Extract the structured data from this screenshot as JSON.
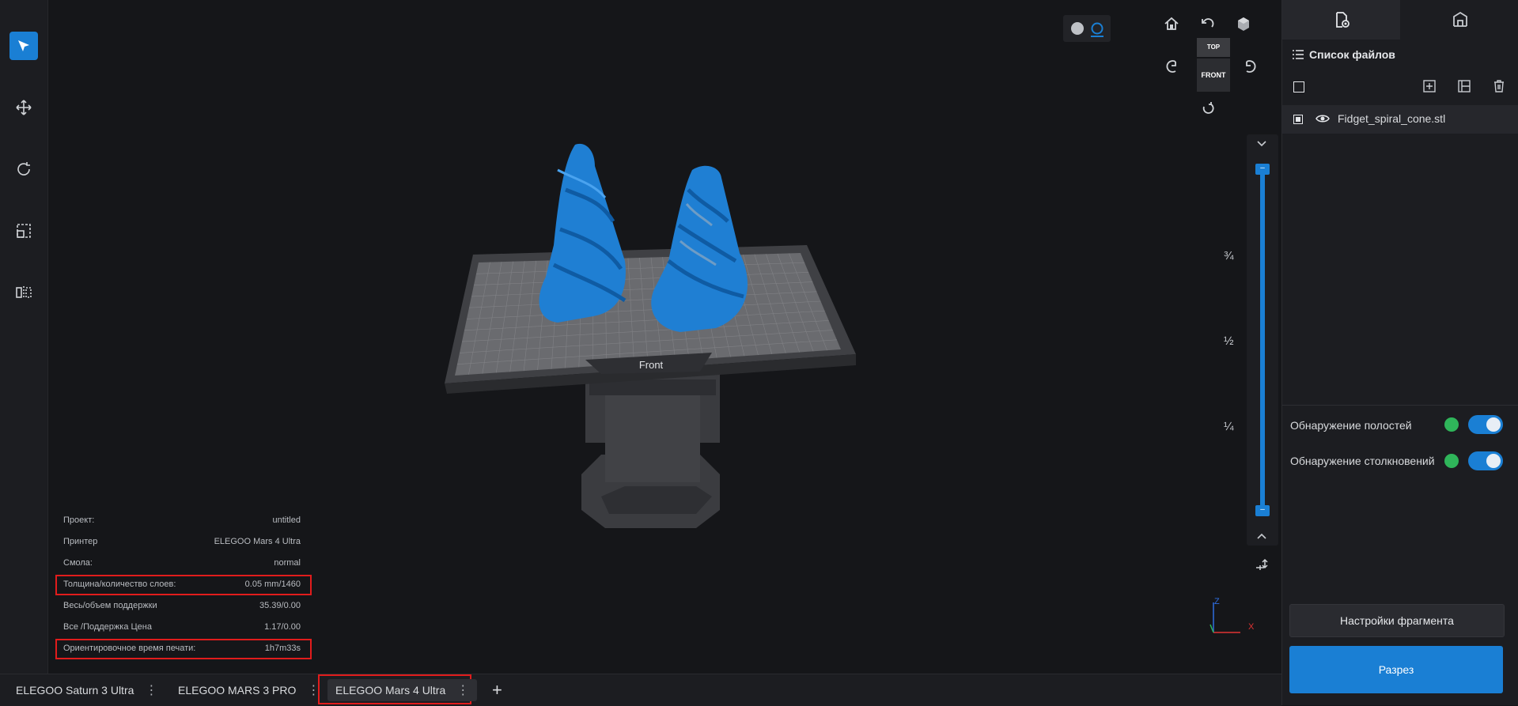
{
  "left_toolbar": {
    "tools": [
      {
        "name": "select",
        "icon": "select-cursor-icon",
        "active": true
      },
      {
        "name": "move",
        "icon": "move-arrows-icon",
        "active": false
      },
      {
        "name": "rotate",
        "icon": "rotate-icon",
        "active": false
      },
      {
        "name": "scale",
        "icon": "scale-icon",
        "active": false
      },
      {
        "name": "mirror",
        "icon": "mirror-icon",
        "active": false
      }
    ]
  },
  "viewport": {
    "plate_label": "Front",
    "view_cube": {
      "top": "TOP",
      "front": "FRONT"
    },
    "slider_marks": [
      "¾",
      "½",
      "¼"
    ],
    "axis": {
      "x": "X",
      "z": "Z"
    }
  },
  "info_panel": {
    "rows": [
      {
        "label": "Проект:",
        "value": "untitled",
        "highlight": false
      },
      {
        "label": "Принтер",
        "value": "ELEGOO Mars 4 Ultra",
        "highlight": false
      },
      {
        "label": "Смола:",
        "value": "normal",
        "highlight": false
      },
      {
        "label": "Толщина/количество слоев:",
        "value": "0.05 mm/1460",
        "highlight": true
      },
      {
        "label": "Весь/объем поддержки",
        "value": "35.39/0.00",
        "highlight": false
      },
      {
        "label": "Все /Поддержка Цена",
        "value": "1.17/0.00",
        "highlight": false
      },
      {
        "label": "Ориентировочное время печати:",
        "value": "1h7m33s",
        "highlight": true
      }
    ]
  },
  "bottom_tabs": [
    {
      "label": "ELEGOO Saturn 3 Ultra",
      "active": false
    },
    {
      "label": "ELEGOO MARS 3 PRO",
      "active": false
    },
    {
      "label": "ELEGOO Mars 4 Ultra",
      "active": true
    }
  ],
  "add_tab_label": "+",
  "right_panel": {
    "file_list_title": "Список файлов",
    "files": [
      {
        "name": "Fidget_spiral_cone.stl"
      }
    ],
    "detection": [
      {
        "label": "Обнаружение полостей",
        "enabled": true
      },
      {
        "label": "Обнаружение столкновений",
        "enabled": true
      }
    ],
    "fragment_settings_label": "Настройки фрагмента",
    "slice_label": "Разрез"
  },
  "colors": {
    "accent": "#1a7fd4",
    "model": "#1f7fd3",
    "highlight": "#e11c1c",
    "bg": "#151619"
  }
}
